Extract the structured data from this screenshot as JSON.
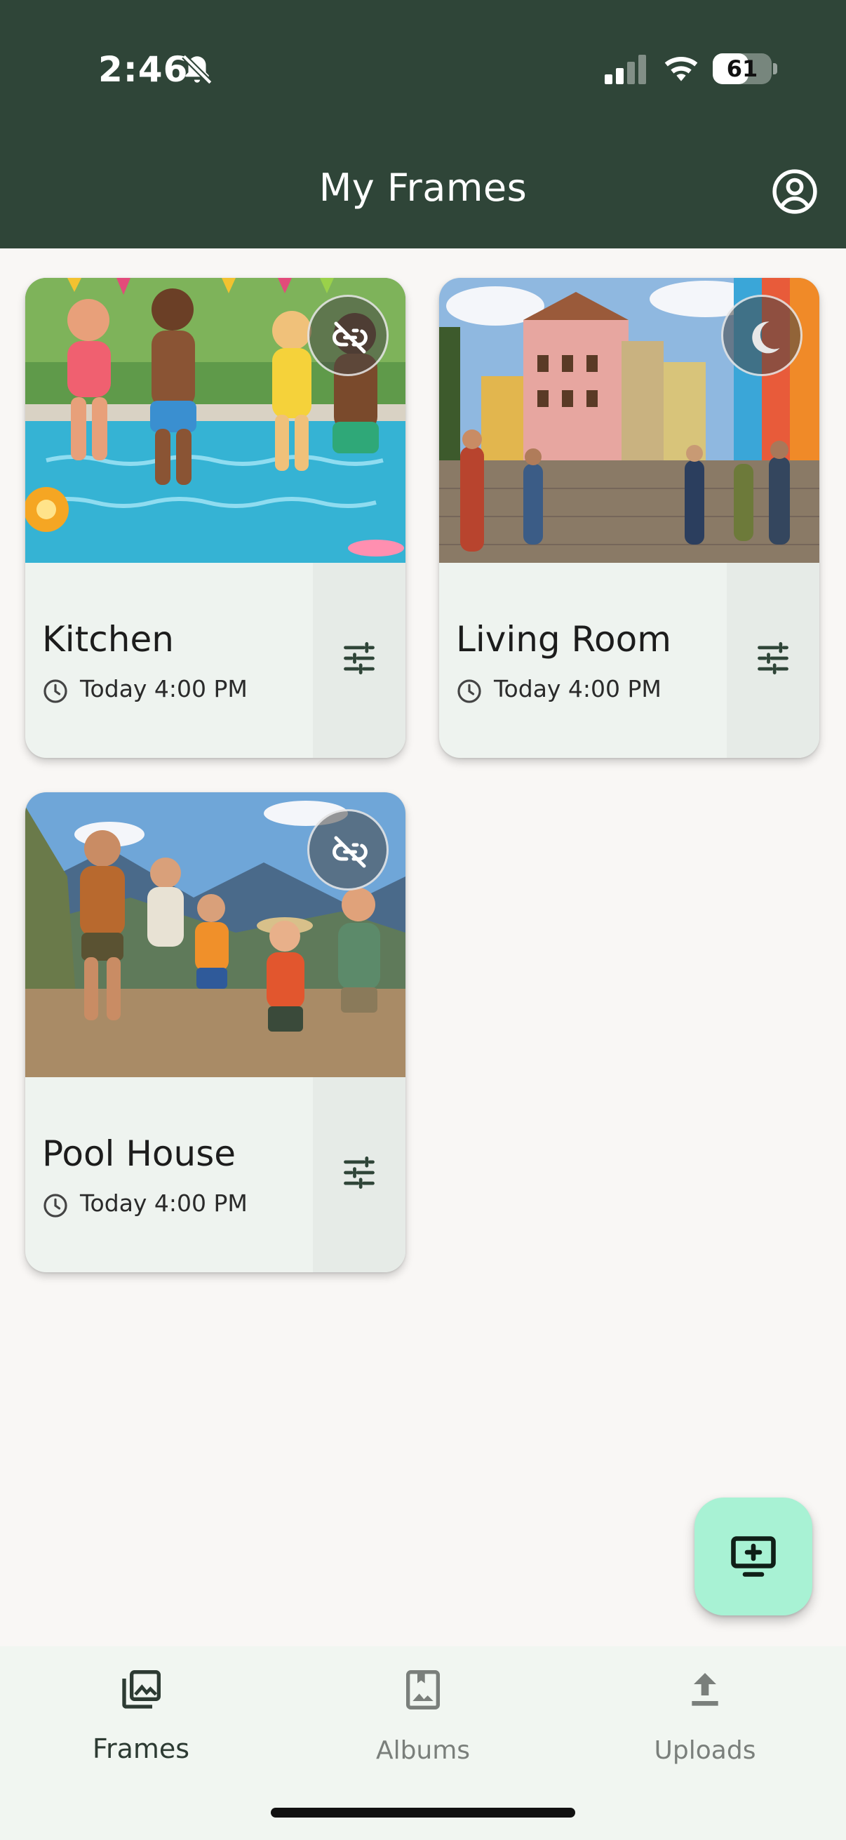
{
  "status_bar": {
    "time": "2:46",
    "battery": "61",
    "battery_level": 0.61
  },
  "header": {
    "title": "My Frames"
  },
  "frames": [
    {
      "name": "Kitchen",
      "time": "Today 4:00 PM",
      "status_icon": "link-off-icon"
    },
    {
      "name": "Living Room",
      "time": "Today 4:00 PM",
      "status_icon": "moon-icon"
    },
    {
      "name": "Pool House",
      "time": "Today 4:00 PM",
      "status_icon": "link-off-icon"
    }
  ],
  "fab": {
    "icon": "add-to-screen-icon"
  },
  "nav": {
    "items": [
      {
        "label": "Frames",
        "icon": "photo-library-icon",
        "active": true
      },
      {
        "label": "Albums",
        "icon": "album-book-icon",
        "active": false
      },
      {
        "label": "Uploads",
        "icon": "upload-icon",
        "active": false
      }
    ]
  },
  "colors": {
    "header_bg": "#2f4538",
    "fab_bg": "#a8f2d4",
    "card_bg": "#eef3ef",
    "page_bg": "#f9f7f5"
  }
}
